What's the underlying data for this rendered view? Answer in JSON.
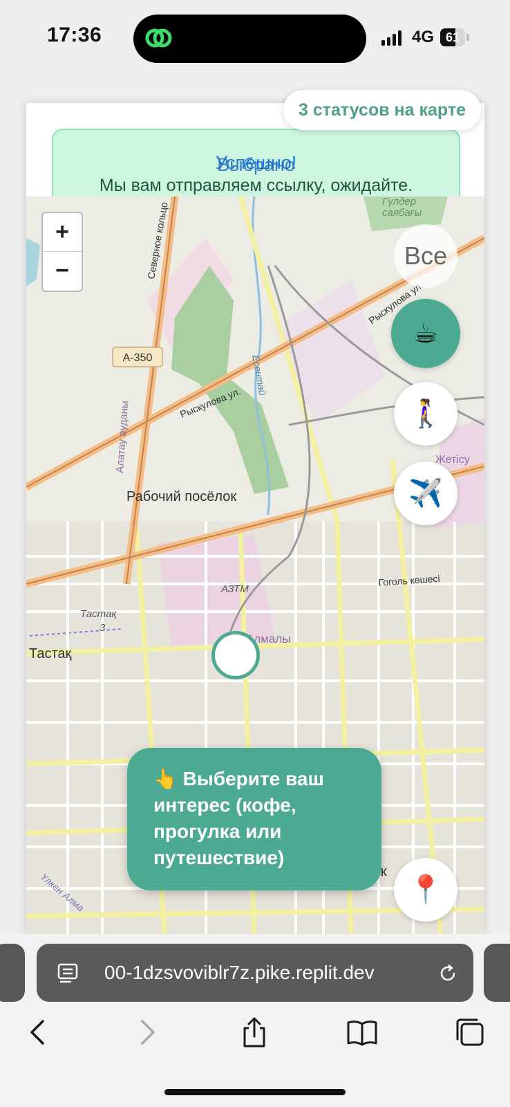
{
  "status_bar": {
    "time": "17:36",
    "network": "4G",
    "battery": "61",
    "battery_level": 0.61
  },
  "banner": {
    "title_a": "Успешно!",
    "title_b": "Выбрано",
    "message": "Мы вам отправляем ссылку, ожидайте."
  },
  "counter": "3 статусов на карте",
  "map": {
    "zoom_in": "+",
    "zoom_out": "−",
    "labels": {
      "kulyer": "Гүлдер",
      "sayabagy": "саябағы",
      "severnoe": "Северное кольцо",
      "a350": "A-350",
      "ryskulova": "Рыскулова ул.",
      "ryskulova2": "Рыскулова ул.",
      "esentai": "Есентай",
      "alatau": "Алатау ауданы",
      "rabochiy": "Рабочий посёлок",
      "zhetysu": "Жетісу",
      "aztm": "АЗТМ",
      "gogol": "Гоголь көшесі",
      "tastak3": "Тастақ",
      "tastak3n": "3",
      "tastak": "Тастақ",
      "almaly": "Алмалы",
      "kok": "Көк",
      "ulken": "Үлкен Алма"
    }
  },
  "filters": {
    "all": "Все",
    "coffee": "☕",
    "walk": "🚶‍♀️",
    "travel": "✈️",
    "pin": "📍",
    "active": "coffee"
  },
  "tooltip": "👆 Выберите ваш интерес (кофе, прогулка или путешествие)",
  "browser": {
    "url": "00-1dzsvoviblr7z.pike.replit.dev"
  },
  "colors": {
    "accent": "#4daa92",
    "banner_bg": "#cdf5df",
    "banner_border": "#8fe3b6"
  }
}
